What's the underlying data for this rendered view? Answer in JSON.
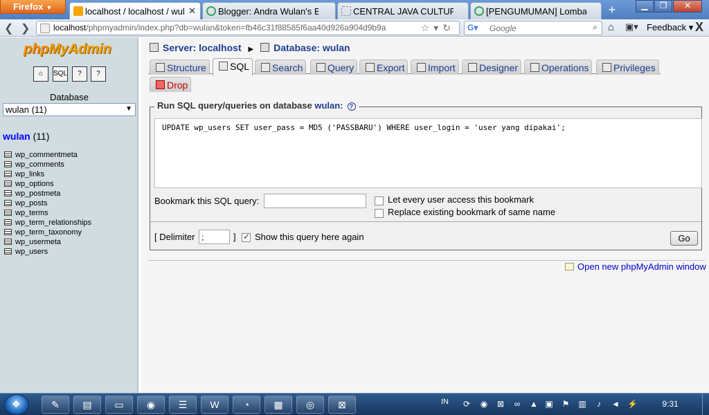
{
  "browser": {
    "app_button": "Firefox",
    "tabs": [
      {
        "title": "localhost / localhost / wul...",
        "favicon_color": "#f7a50b",
        "active": true
      },
      {
        "title": "Blogger: Andra Wulan's Bl...",
        "favicon_color": "#3aa757",
        "active": false
      },
      {
        "title": "CENTRAL JAVA CULTURE ...",
        "favicon_color": "#dddddd",
        "active": false
      },
      {
        "title": "[PENGUMUMAN] Lomba ...",
        "favicon_color": "#3aa757",
        "active": false
      }
    ],
    "new_tab": "+",
    "url_host": "localhost",
    "url_path": "/phpmyadmin/index.php?db=wulan&token=fb46c31f88585f6aa40d926a904d9b9a",
    "search_placeholder": "Google",
    "feedback_label": "Feedback"
  },
  "sidebar": {
    "logo_php": "php",
    "logo_myadmin": "MyAdmin",
    "database_label": "Database",
    "database_select": "wulan (11)",
    "db_name": "wulan",
    "db_count": "(11)",
    "tables": [
      "wp_commentmeta",
      "wp_comments",
      "wp_links",
      "wp_options",
      "wp_postmeta",
      "wp_posts",
      "wp_terms",
      "wp_term_relationships",
      "wp_term_taxonomy",
      "wp_usermeta",
      "wp_users"
    ]
  },
  "breadcrumb": {
    "server": "Server: localhost",
    "database": "Database: wulan"
  },
  "tabs": {
    "structure": "Structure",
    "sql": "SQL",
    "search": "Search",
    "query": "Query",
    "export": "Export",
    "import": "Import",
    "designer": "Designer",
    "operations": "Operations",
    "privileges": "Privileges",
    "drop": "Drop"
  },
  "sql_panel": {
    "legend_prefix": "Run SQL query/queries on database",
    "legend_db": "wulan:",
    "query": "UPDATE wp_users SET user_pass = MD5 ('PASSBARU') WHERE user_login = 'user yang dipakai';",
    "bookmark_label": "Bookmark this SQL query:",
    "cb_every_user": "Let every user access this bookmark",
    "cb_replace": "Replace existing bookmark of same name",
    "delimiter_label": "[ Delimiter",
    "delimiter_value": ";",
    "delimiter_close": "]",
    "show_query_again": "Show this query here again",
    "go_label": "Go"
  },
  "footer_link": "Open new phpMyAdmin window",
  "taskbar": {
    "lang": "IN",
    "clock": "9:31"
  }
}
